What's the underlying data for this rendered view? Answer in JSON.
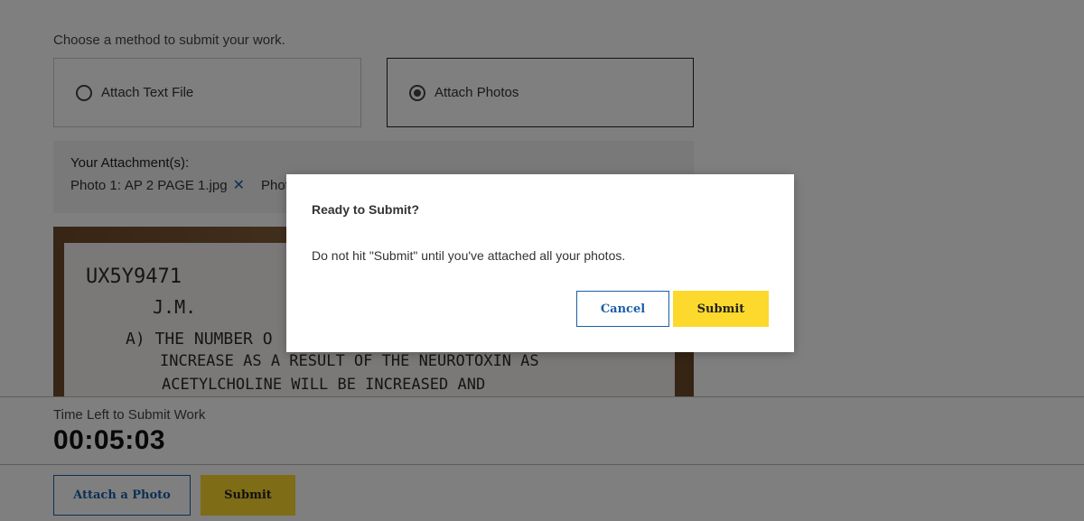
{
  "instructions": "Choose a method to submit your work.",
  "methods": [
    {
      "label": "Attach Text File",
      "selected": false
    },
    {
      "label": "Attach Photos",
      "selected": true
    }
  ],
  "attachments": {
    "title": "Your Attachment(s):",
    "items": [
      {
        "photo_label": "Photo 1:",
        "filename": "AP 2 PAGE 1.jpg"
      },
      {
        "photo_label": "Phot",
        "filename": ""
      }
    ]
  },
  "photo_preview": {
    "lines": [
      "UX5Y9471",
      "J.M.",
      "A) THE NUMBER O",
      "INCREASE AS A RESULT OF THE NEUROTOXIN AS",
      "ACETYLCHOLINE WILL BE INCREASED AND"
    ]
  },
  "timer": {
    "label": "Time Left to Submit Work",
    "value": "00:05:03"
  },
  "actions": {
    "attach_label": "Attach a Photo",
    "submit_label": "Submit"
  },
  "modal": {
    "title": "Ready to Submit?",
    "body": "Do not hit \"Submit\" until you've attached all your photos.",
    "cancel_label": "Cancel",
    "submit_label": "Submit"
  },
  "colors": {
    "accent_blue": "#1a5fa8",
    "submit_yellow": "#fcd92c",
    "overlay": "rgba(0,0,0,0.5)"
  }
}
